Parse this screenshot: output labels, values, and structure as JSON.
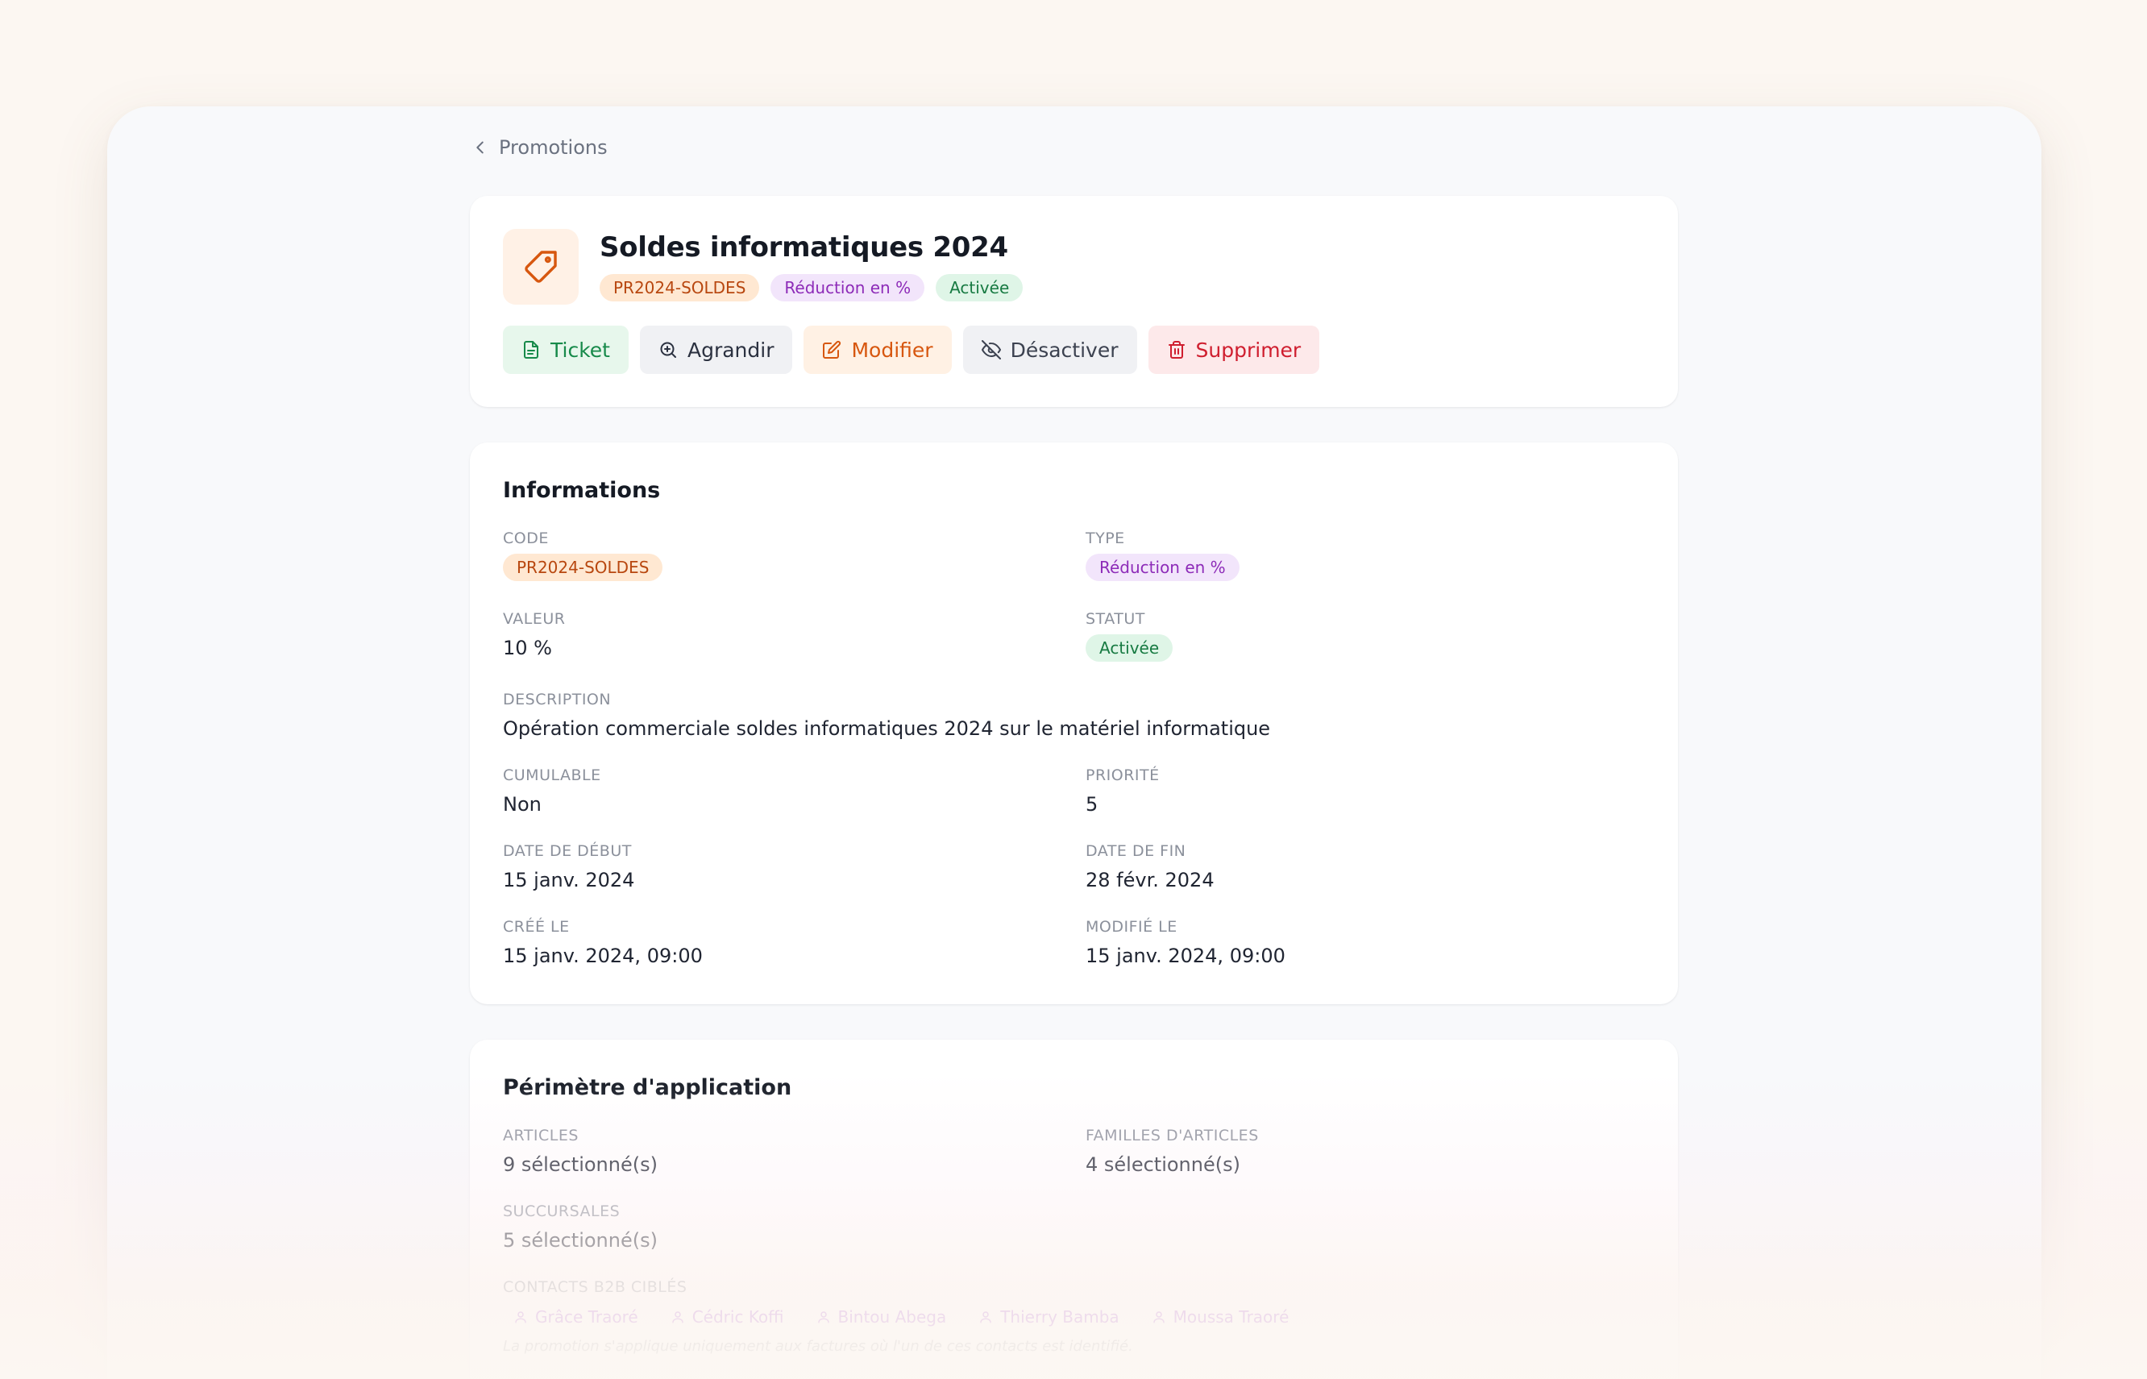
{
  "breadcrumb": {
    "label": "Promotions"
  },
  "header": {
    "title": "Soldes informatiques 2024",
    "badges": [
      "PR2024-SOLDES",
      "Réduction en %",
      "Activée"
    ],
    "actions": {
      "ticket": "Ticket",
      "zoom": "Agrandir",
      "edit": "Modifier",
      "disable": "Désactiver",
      "delete": "Supprimer"
    }
  },
  "info": {
    "title": "Informations",
    "code_label": "CODE",
    "code_value": "PR2024-SOLDES",
    "type_label": "TYPE",
    "type_value": "Réduction en %",
    "valeur_label": "VALEUR",
    "valeur_value": "10 %",
    "statut_label": "STATUT",
    "statut_value": "Activée",
    "description_label": "DESCRIPTION",
    "description_value": "Opération commerciale soldes informatiques 2024 sur le matériel informatique",
    "cumulable_label": "CUMULABLE",
    "cumulable_value": "Non",
    "priorite_label": "PRIORITÉ",
    "priorite_value": "5",
    "debut_label": "DATE DE DÉBUT",
    "debut_value": "15 janv. 2024",
    "fin_label": "DATE DE FIN",
    "fin_value": "28 févr. 2024",
    "cree_label": "CRÉÉ LE",
    "cree_value": "15 janv. 2024, 09:00",
    "modifie_label": "MODIFIÉ LE",
    "modifie_value": "15 janv. 2024, 09:00"
  },
  "scope": {
    "title": "Périmètre d'application",
    "articles_label": "ARTICLES",
    "articles_value": "9 sélectionné(s)",
    "familles_label": "FAMILLES D'ARTICLES",
    "familles_value": "4 sélectionné(s)",
    "succursales_label": "SUCCURSALES",
    "succursales_value": "5 sélectionné(s)",
    "contacts_label": "CONTACTS B2B CIBLÉS",
    "contacts": [
      "Grâce Traoré",
      "Cédric Koffi",
      "Bintou Abega",
      "Thierry Bamba",
      "Moussa Traoré"
    ],
    "note": "La promotion s'applique uniquement aux factures où l'un de ces contacts est identifié."
  },
  "colors": {
    "accent_orange": "#d7570f",
    "success_green": "#178a4a",
    "danger_red": "#cf1e2f",
    "purple": "#8d2bb8"
  }
}
